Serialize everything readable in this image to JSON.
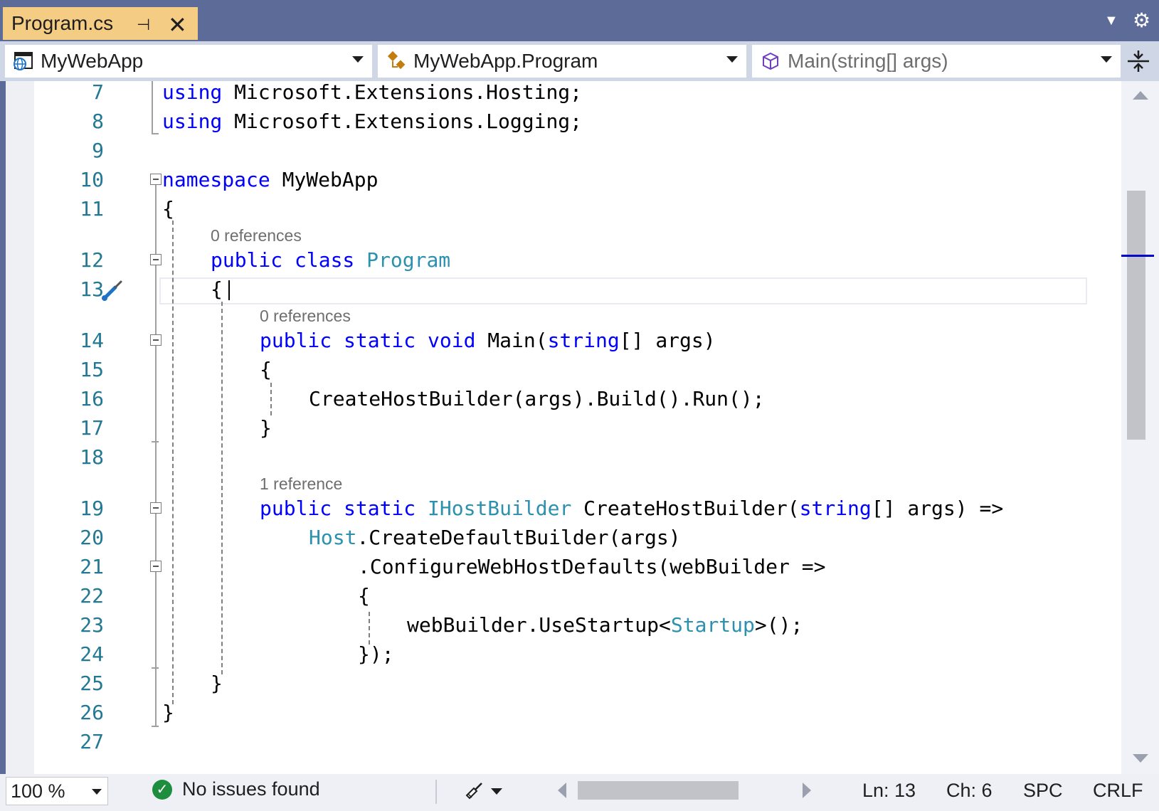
{
  "tab": {
    "title": "Program.cs",
    "pin_icon": "pin-icon",
    "close_icon": "close-icon"
  },
  "navbar": {
    "project": "MyWebApp",
    "type": "MyWebApp.Program",
    "member": "Main(string[] args)"
  },
  "editor": {
    "lines": [
      {
        "n": "7"
      },
      {
        "n": "8"
      },
      {
        "n": "9"
      },
      {
        "n": "10"
      },
      {
        "n": "11"
      },
      {
        "n": "12"
      },
      {
        "n": "13"
      },
      {
        "n": "14"
      },
      {
        "n": "15"
      },
      {
        "n": "16"
      },
      {
        "n": "17"
      },
      {
        "n": "18"
      },
      {
        "n": "19"
      },
      {
        "n": "20"
      },
      {
        "n": "21"
      },
      {
        "n": "22"
      },
      {
        "n": "23"
      },
      {
        "n": "24"
      },
      {
        "n": "25"
      },
      {
        "n": "26"
      },
      {
        "n": "27"
      }
    ],
    "code": {
      "l7_kw": "using",
      "l7_rest": " Microsoft.Extensions.Hosting;",
      "l8_kw": "using",
      "l8_rest": " Microsoft.Extensions.Logging;",
      "l10_kw": "namespace",
      "l10_rest": " MyWebApp",
      "l11": "{",
      "l12_kw": "public class",
      "l12_sp": " ",
      "l12_cls": "Program",
      "l13": "{",
      "l14_kw": "public static void",
      "l14_name": " Main(",
      "l14_type": "string",
      "l14_rest": "[] args)",
      "l15": "{",
      "l16": "CreateHostBuilder(args).Build().Run();",
      "l17": "}",
      "l19_kw": "public static",
      "l19_sp": " ",
      "l19_type": "IHostBuilder",
      "l19_name": " CreateHostBuilder(",
      "l19_type2": "string",
      "l19_rest": "[] args) =>",
      "l20_cls": "Host",
      "l20_rest": ".CreateDefaultBuilder(args)",
      "l21": ".ConfigureWebHostDefaults(webBuilder =>",
      "l22": "{",
      "l23_a": "webBuilder.UseStartup<",
      "l23_cls": "Startup",
      "l23_b": ">();",
      "l24": "});",
      "l25": "}",
      "l26": "}"
    },
    "lens": {
      "program_refs": "0 references",
      "main_refs": "0 references",
      "builder_refs": "1 reference"
    }
  },
  "status": {
    "zoom": "100 %",
    "issues": "No issues found",
    "line": "Ln: 13",
    "char": "Ch: 6",
    "whitespace": "SPC",
    "line_ending": "CRLF"
  },
  "colors": {
    "keyword": "#0000ff",
    "type": "#2b91af",
    "line_number": "#237893",
    "tab_active": "#f5cc84",
    "chrome": "#5d6b99"
  }
}
